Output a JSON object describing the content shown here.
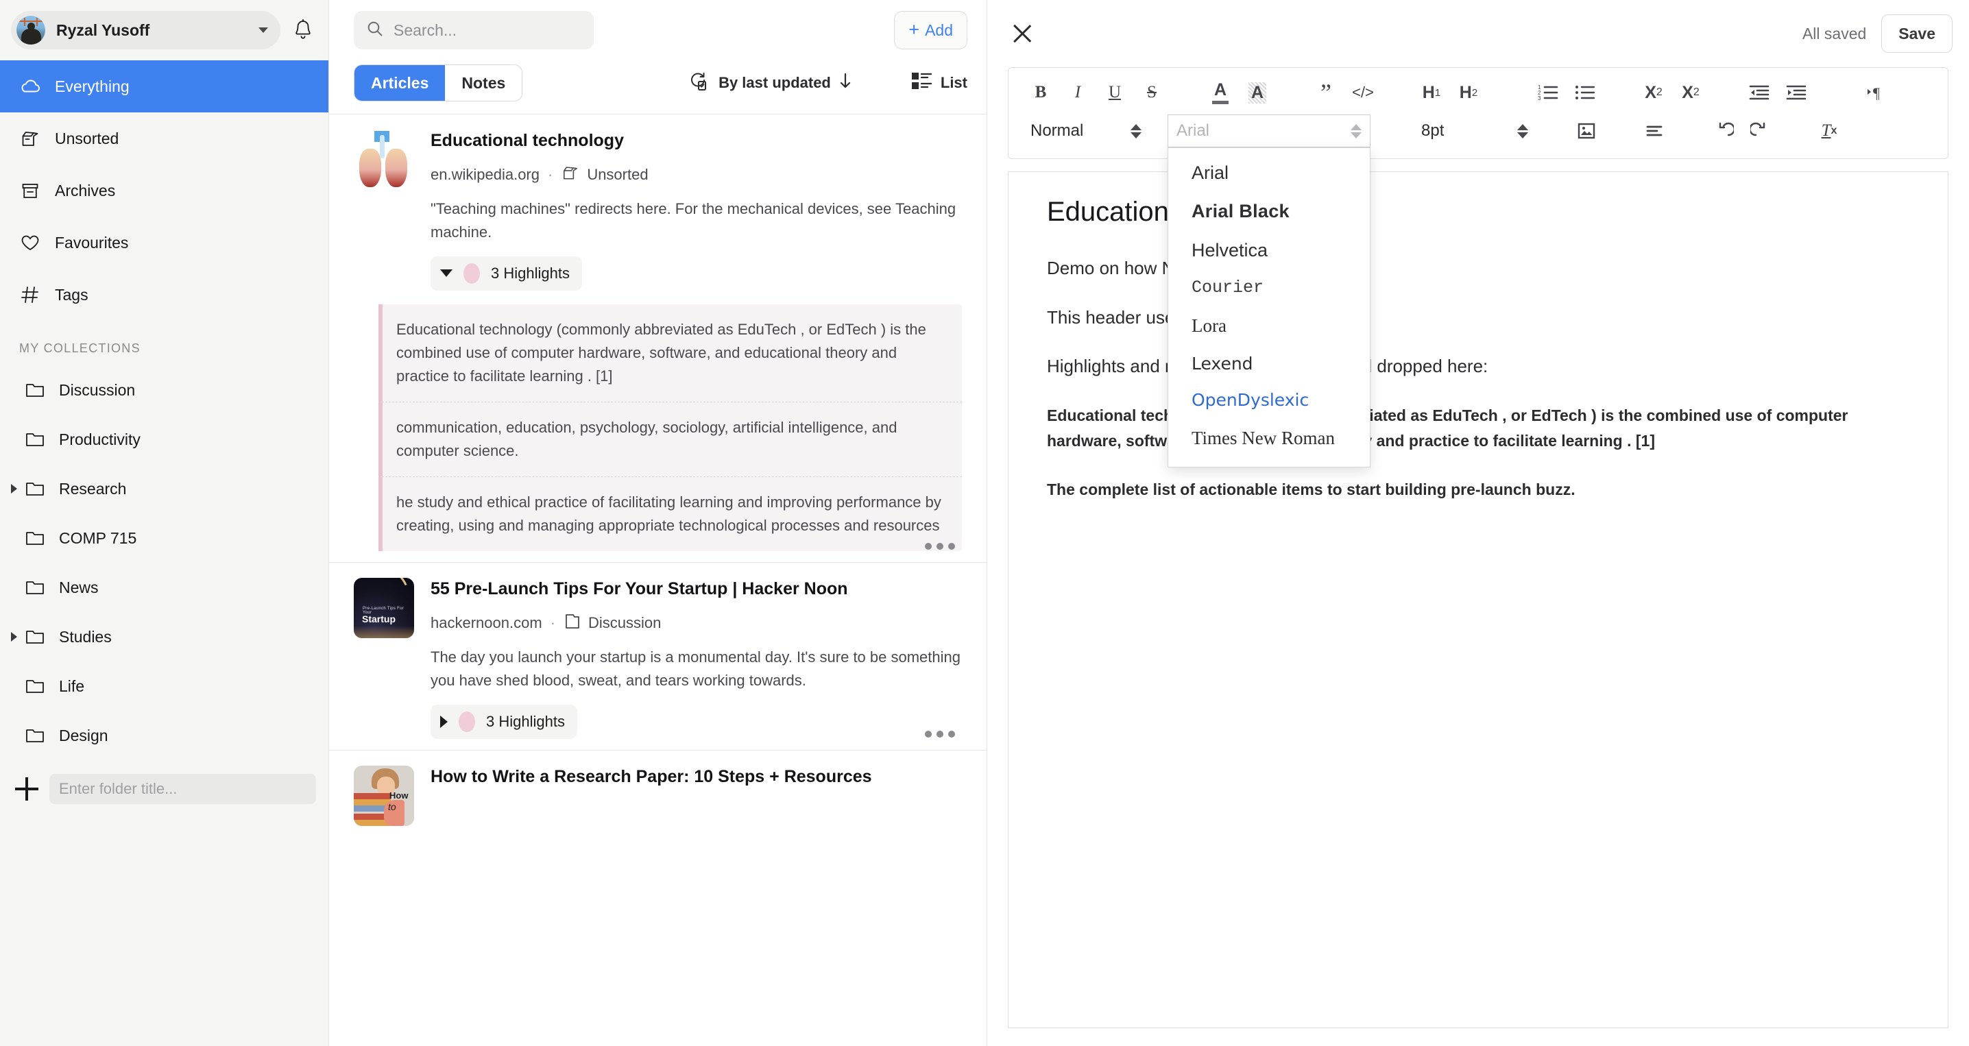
{
  "sidebar": {
    "account": {
      "name": "Ryzal Yusoff"
    },
    "nav": [
      {
        "label": "Everything",
        "icon": "cloud-icon",
        "active": true
      },
      {
        "label": "Unsorted",
        "icon": "box-open-icon",
        "active": false
      },
      {
        "label": "Archives",
        "icon": "archive-box-icon",
        "active": false
      },
      {
        "label": "Favourites",
        "icon": "heart-icon",
        "active": false
      },
      {
        "label": "Tags",
        "icon": "hash-icon",
        "active": false
      }
    ],
    "collections_title": "MY COLLECTIONS",
    "collections": [
      {
        "label": "Discussion",
        "expandable": false
      },
      {
        "label": "Productivity",
        "expandable": false
      },
      {
        "label": "Research",
        "expandable": true
      },
      {
        "label": "COMP 715",
        "expandable": false
      },
      {
        "label": "News",
        "expandable": false
      },
      {
        "label": "Studies",
        "expandable": true
      },
      {
        "label": "Life",
        "expandable": false
      },
      {
        "label": "Design",
        "expandable": false
      }
    ],
    "new_folder_placeholder": "Enter folder title...",
    "new_folder_value": ""
  },
  "list": {
    "search_placeholder": "Search...",
    "search_value": "",
    "add_label": "Add",
    "tabs": [
      {
        "label": "Articles",
        "selected": true
      },
      {
        "label": "Notes",
        "selected": false
      }
    ],
    "sort_label": "By last updated",
    "view_label": "List",
    "cards": [
      {
        "title": "Educational technology",
        "domain": "en.wikipedia.org",
        "collection": "Unsorted",
        "excerpt": "\"Teaching machines\" redirects here. For the mechanical devices, see Teaching machine.",
        "highlights_label": "3 Highlights",
        "expanded": true,
        "highlights": [
          "Educational technology  (commonly abbreviated as  EduTech , or  EdTech ) is the combined use of computer hardware, software, and educational theory and practice to facilitate  learning . [1]",
          "communication, education, psychology, sociology, artificial intelligence, and computer science.",
          "he study and ethical practice of facilitating learning and improving performance by creating, using and managing appropriate technological processes and resources"
        ]
      },
      {
        "title": "55 Pre-Launch Tips For Your Startup | Hacker Noon",
        "domain": "hackernoon.com",
        "collection": "Discussion",
        "excerpt": "The day you launch your startup is a monumental day. It's sure to be something you have shed blood, sweat, and tears working towards.",
        "highlights_label": "3 Highlights",
        "expanded": false,
        "highlights": []
      },
      {
        "title": "How to Write a Research Paper: 10 Steps + Resources",
        "domain": "",
        "collection": "",
        "excerpt": "",
        "highlights_label": "",
        "expanded": false,
        "highlights": []
      }
    ]
  },
  "editor": {
    "status": "All saved",
    "save_label": "Save",
    "toolbar": {
      "bold": "B",
      "italic": "I",
      "underline": "U",
      "strike": "S",
      "text_color": "A",
      "highlight_color": "A",
      "blockquote": "”",
      "code": "</>",
      "h1": "H",
      "h1_sub": "1",
      "h2": "H",
      "h2_sub": "2",
      "ordered_list": "ordered-list-icon",
      "bullet_list": "bullet-list-icon",
      "subscript": "X",
      "subscript_sub": "2",
      "superscript": "X",
      "superscript_sup": "2",
      "outdent": "outdent-icon",
      "indent": "indent-icon",
      "direction": "text-direction-icon",
      "style_value": "Normal",
      "font_placeholder": "Arial",
      "font_value": "",
      "size_value": "8pt",
      "image": "image-icon",
      "align": "align-icon",
      "undo": "undo-icon",
      "redo": "redo-icon",
      "clear_format": "clear-format-icon"
    },
    "font_menu": {
      "open": true,
      "options": [
        {
          "label": "Arial",
          "cls": "f-arial",
          "selected": false
        },
        {
          "label": "Arial Black",
          "cls": "f-black",
          "selected": false
        },
        {
          "label": "Helvetica",
          "cls": "f-helv",
          "selected": false
        },
        {
          "label": "Courier",
          "cls": "f-courier",
          "selected": false
        },
        {
          "label": "Lora",
          "cls": "f-lora",
          "selected": false
        },
        {
          "label": "Lexend",
          "cls": "f-lexend",
          "selected": false
        },
        {
          "label": "OpenDyslexic",
          "cls": "f-odys",
          "selected": true
        },
        {
          "label": "Times New Roman",
          "cls": "f-times",
          "selected": false
        }
      ]
    },
    "document": {
      "title": "Educational Technologies",
      "p1": "Demo on how Notes work",
      "p2": "This header uses the OpenDyslexic font",
      "p3": "Highlights and notes can be dragged and dropped here:",
      "p4": "Educational technology (commonly abbreviated as EduTech , or EdTech ) is the combined use of computer hardware, software, and educational theory and practice to facilitate learning . [1]",
      "p5": "The complete list of actionable items to start building pre-launch buzz."
    }
  }
}
